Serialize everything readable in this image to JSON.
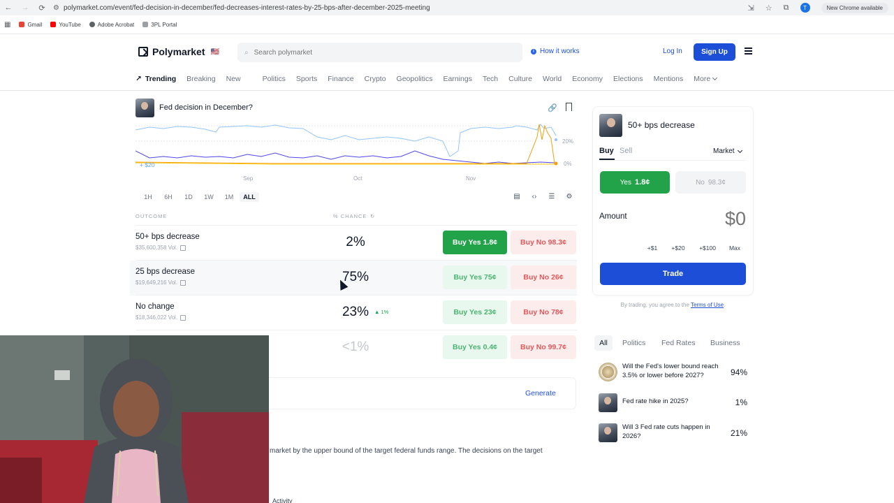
{
  "browser": {
    "url": "polymarket.com/event/fed-decision-in-december/fed-decreases-interest-rates-by-25-bps-after-december-2025-meeting",
    "profile_initial": "T",
    "update_label": "New Chrome available",
    "bookmarks": [
      "Gmail",
      "YouTube",
      "Adobe Acrobat",
      "3PL Portal"
    ]
  },
  "header": {
    "brand": "Polymarket",
    "search_placeholder": "Search polymarket",
    "how_it_works": "How it works",
    "login": "Log In",
    "signup": "Sign Up"
  },
  "categories": {
    "trending": "Trending",
    "items": [
      "Breaking",
      "New",
      "Politics",
      "Sports",
      "Finance",
      "Crypto",
      "Geopolitics",
      "Earnings",
      "Tech",
      "Culture",
      "World",
      "Economy",
      "Elections",
      "Mentions"
    ],
    "more": "More"
  },
  "market": {
    "title": "Fed decision in December?",
    "chart_axis": {
      "x_ticks": [
        "Sep",
        "Oct",
        "Nov"
      ],
      "y_ticks": [
        "20%",
        "0%"
      ],
      "note": "+ $20"
    },
    "time_filters": [
      "1H",
      "6H",
      "1D",
      "1W",
      "1M",
      "ALL"
    ],
    "active_filter": "ALL",
    "col_outcome": "OUTCOME",
    "col_chance": "% CHANCE",
    "outcomes": [
      {
        "name": "50+ bps decrease",
        "vol": "$35,600,358 Vol.",
        "chance": "2%",
        "delta": "",
        "yes": "Buy Yes 1.8¢",
        "no": "Buy No 98.3¢"
      },
      {
        "name": "25 bps decrease",
        "vol": "$19,649,216 Vol.",
        "chance": "75%",
        "delta": "",
        "yes": "Buy Yes 75¢",
        "no": "Buy No 26¢"
      },
      {
        "name": "No change",
        "vol": "$18,346,022 Vol.",
        "chance": "23%",
        "delta": "▲ 1%",
        "yes": "Buy Yes 23¢",
        "no": "Buy No 78¢"
      },
      {
        "name": "",
        "vol": "",
        "chance": "<1%",
        "delta": "",
        "yes": "Buy Yes 0.4¢",
        "no": "Buy No 99.7¢"
      }
    ],
    "generate": "Generate",
    "rules_excerpt": "market by the upper bound of the target federal funds range. The decisions on the target",
    "activity": "Activity"
  },
  "trade": {
    "title": "50+ bps decrease",
    "tab_buy": "Buy",
    "tab_sell": "Sell",
    "order_type": "Market",
    "yes_label": "Yes",
    "yes_price": "1.8¢",
    "no_label": "No",
    "no_price": "98.3¢",
    "amount_label": "Amount",
    "amount_value": "$0",
    "quick": [
      "+$1",
      "+$20",
      "+$100",
      "Max"
    ],
    "trade_button": "Trade",
    "terms_prefix": "By trading, you agree to the",
    "terms_link": "Terms of Use",
    "terms_suffix": "."
  },
  "related": {
    "tabs": [
      "All",
      "Politics",
      "Fed Rates",
      "Business"
    ],
    "items": [
      {
        "question": "Will the Fed's lower bound reach 3.5% or lower before 2027?",
        "chance": "94%",
        "thumb": "seal"
      },
      {
        "question": "Fed rate hike in 2025?",
        "chance": "1%",
        "thumb": "portrait"
      },
      {
        "question": "Will 3 Fed rate cuts happen in 2026?",
        "chance": "21%",
        "thumb": "portrait"
      }
    ]
  },
  "colors": {
    "brand_blue": "#1d4ed8",
    "yes_green": "#22a34a",
    "no_red": "#e0585a"
  }
}
